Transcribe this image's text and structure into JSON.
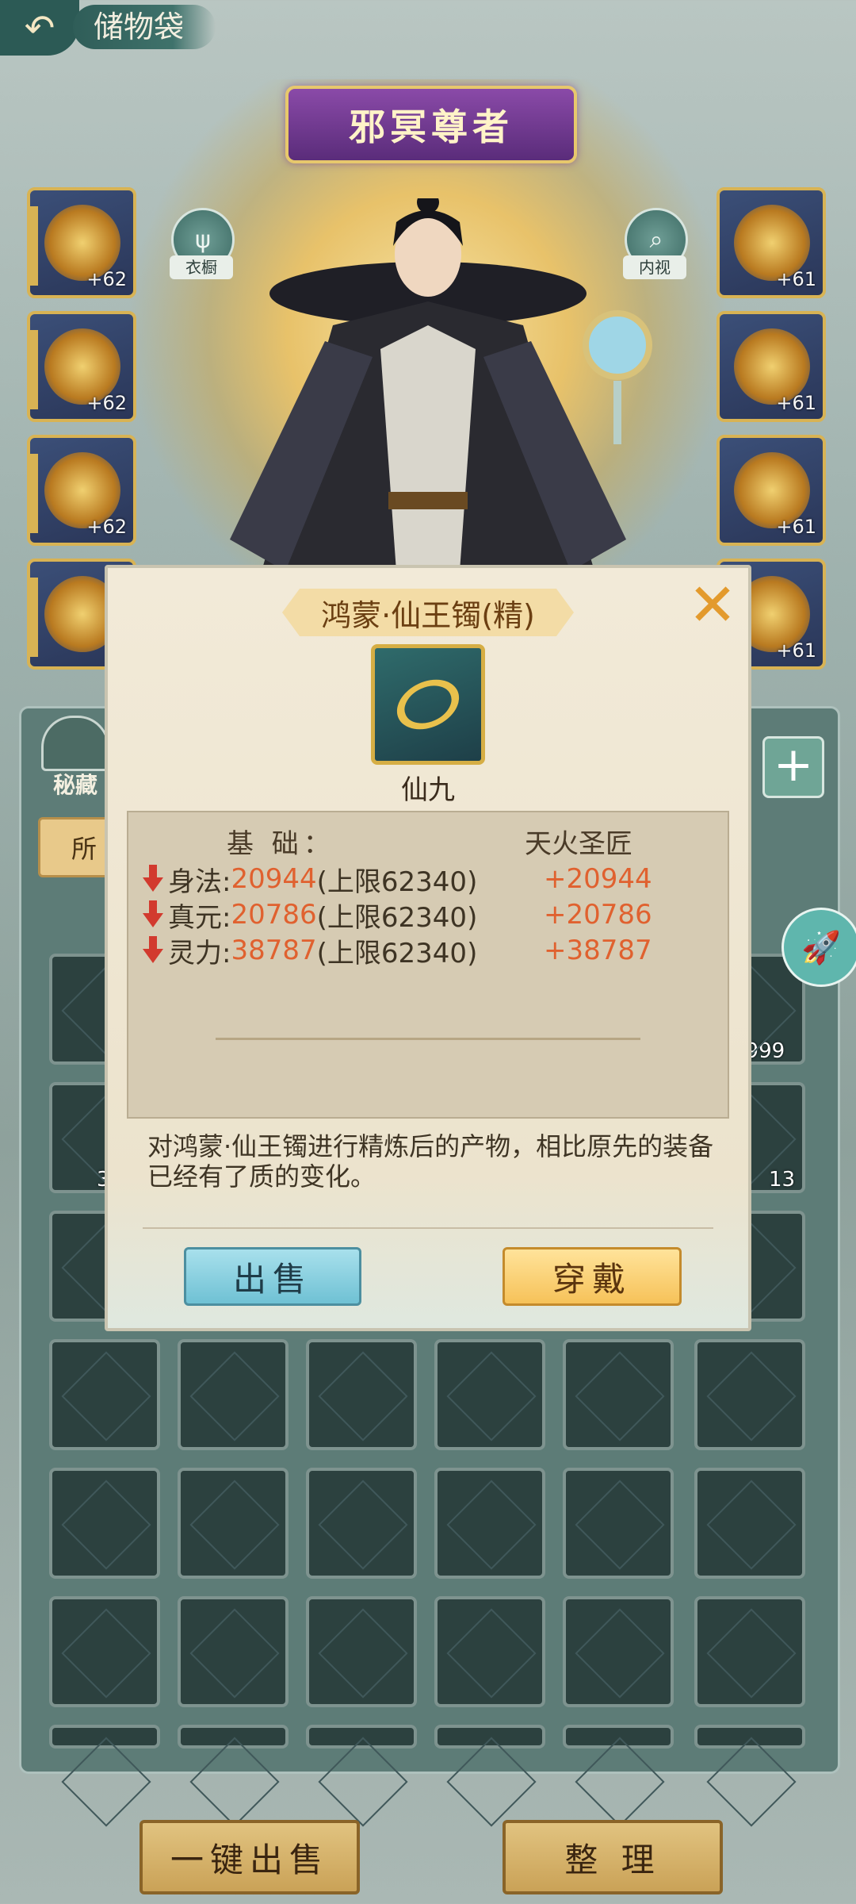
{
  "header": {
    "back_icon": "back-arrow-icon",
    "title": "储物袋"
  },
  "character": {
    "name": "邪冥尊者",
    "wardrobe_label": "衣橱",
    "inspect_label": "内视",
    "left_slots": [
      {
        "level": "+62"
      },
      {
        "level": "+62"
      },
      {
        "level": "+62"
      },
      {
        "level": ""
      }
    ],
    "right_slots": [
      {
        "level": "+61"
      },
      {
        "level": "+61"
      },
      {
        "level": "+61"
      },
      {
        "level": "+61"
      }
    ]
  },
  "bag": {
    "secret_label": "秘藏",
    "tab_all": "所",
    "counts": [
      "9999",
      "3",
      "13"
    ]
  },
  "dialog": {
    "item_name": "鸿蒙·仙王镯(精)",
    "grade": "仙九",
    "header_base": "基 础：",
    "header_craft": "天火圣匠",
    "stats": [
      {
        "name": "身法:",
        "value": "20944",
        "limit": "(上限62340)",
        "bonus": "+20944"
      },
      {
        "name": "真元:",
        "value": "20786",
        "limit": "(上限62340)",
        "bonus": "+20786"
      },
      {
        "name": "灵力:",
        "value": "38787",
        "limit": "(上限62340)",
        "bonus": "+38787"
      }
    ],
    "description": "对鸿蒙·仙王镯进行精炼后的产物，相比原先的装备已经有了质的变化。",
    "sell_label": "出售",
    "wear_label": "穿戴"
  },
  "bottom": {
    "sell_all_label": "一键出售",
    "sort_label": "整 理"
  },
  "colors": {
    "accent": "#e0612f",
    "frame_gold": "#d8b354",
    "panel": "#5d7c77"
  }
}
